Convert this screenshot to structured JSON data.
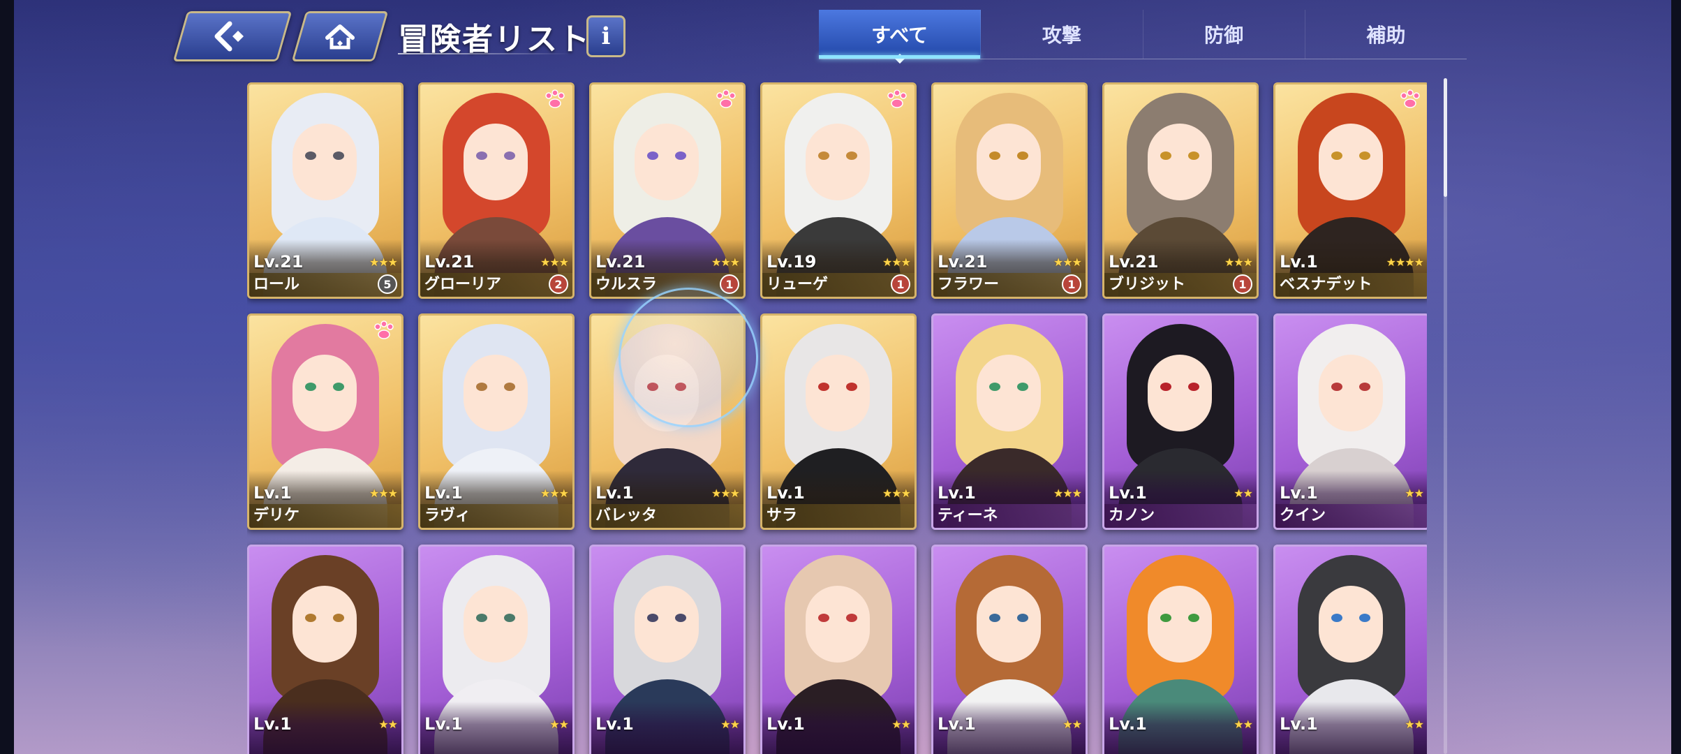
{
  "header": {
    "title": "冒険者リスト",
    "info_label": "i",
    "back_icon": "back-arrow-icon",
    "home_icon": "home-icon"
  },
  "tabs": [
    {
      "label": "すべて",
      "active": true
    },
    {
      "label": "攻撃",
      "active": false
    },
    {
      "label": "防御",
      "active": false
    },
    {
      "label": "補助",
      "active": false
    }
  ],
  "colors": {
    "gold_card": "#f0c068",
    "purple_card": "#a45fd6",
    "tab_active": "#2f5ec9",
    "star": "#ffd54a"
  },
  "adventurers": [
    {
      "name": "ロール",
      "level": "Lv.21",
      "stars": 3,
      "rank": "5",
      "frame": "gold",
      "hair": "#e8ecf4",
      "outfit": "#dfe8f6",
      "eye": "#5b5b66",
      "paw": false
    },
    {
      "name": "グローリア",
      "level": "Lv.21",
      "stars": 3,
      "rank": "2",
      "frame": "gold",
      "hair": "#d4472c",
      "outfit": "#7a4a3a",
      "eye": "#8a6fb0",
      "paw": true
    },
    {
      "name": "ウルスラ",
      "level": "Lv.21",
      "stars": 3,
      "rank": "1",
      "frame": "gold",
      "hair": "#eeeee6",
      "outfit": "#6a4ea0",
      "eye": "#7b62c8",
      "paw": true
    },
    {
      "name": "リューゲ",
      "level": "Lv.19",
      "stars": 3,
      "rank": "1",
      "frame": "gold",
      "hair": "#f0f0ee",
      "outfit": "#3a3a3a",
      "eye": "#c58a3a",
      "paw": true
    },
    {
      "name": "フラワー",
      "level": "Lv.21",
      "stars": 3,
      "rank": "1",
      "frame": "gold",
      "hair": "#e7bc7a",
      "outfit": "#b9c9e8",
      "eye": "#c48a2a",
      "paw": false
    },
    {
      "name": "ブリジット",
      "level": "Lv.21",
      "stars": 3,
      "rank": "1",
      "frame": "gold",
      "hair": "#8c7d70",
      "outfit": "#5b4a36",
      "eye": "#c8922a",
      "paw": false
    },
    {
      "name": "ベスナデット",
      "level": "Lv.1",
      "stars": 4,
      "rank": "",
      "frame": "gold",
      "hair": "#c8461e",
      "outfit": "#2e2420",
      "eye": "#c8922a",
      "paw": true
    },
    {
      "name": "デリケ",
      "level": "Lv.1",
      "stars": 3,
      "rank": "",
      "frame": "gold",
      "hair": "#e27aa0",
      "outfit": "#f4ede6",
      "eye": "#3f9a6a",
      "paw": true
    },
    {
      "name": "ラヴィ",
      "level": "Lv.1",
      "stars": 3,
      "rank": "",
      "frame": "gold",
      "hair": "#dfe5f2",
      "outfit": "#eef1f7",
      "eye": "#b07a40",
      "paw": false
    },
    {
      "name": "バレッタ",
      "level": "Lv.1",
      "stars": 3,
      "rank": "",
      "frame": "gold",
      "hair": "#f2d8c8",
      "outfit": "#2f2a3a",
      "eye": "#c23a3a",
      "paw": false
    },
    {
      "name": "サラ",
      "level": "Lv.1",
      "stars": 3,
      "rank": "",
      "frame": "gold",
      "hair": "#e8e6e6",
      "outfit": "#1f1f22",
      "eye": "#c0332e",
      "paw": false
    },
    {
      "name": "ティーネ",
      "level": "Lv.1",
      "stars": 3,
      "rank": "",
      "frame": "purple",
      "hair": "#f3d58a",
      "outfit": "#3a2a2a",
      "eye": "#3f9a6a",
      "paw": false
    },
    {
      "name": "カノン",
      "level": "Lv.1",
      "stars": 2,
      "rank": "",
      "frame": "purple",
      "hair": "#1d1a22",
      "outfit": "#2a2a30",
      "eye": "#b8222a",
      "paw": false
    },
    {
      "name": "クイン",
      "level": "Lv.1",
      "stars": 2,
      "rank": "",
      "frame": "purple",
      "hair": "#f1eeee",
      "outfit": "#d8d0d0",
      "eye": "#b83a3a",
      "paw": false
    },
    {
      "name": "",
      "level": "Lv.1",
      "stars": 2,
      "rank": "",
      "frame": "purple",
      "hair": "#6a4026",
      "outfit": "#4a2e1e",
      "eye": "#b07a30",
      "paw": false
    },
    {
      "name": "",
      "level": "Lv.1",
      "stars": 2,
      "rank": "",
      "frame": "purple",
      "hair": "#ecebef",
      "outfit": "#f0eef2",
      "eye": "#4a7a6a",
      "paw": false
    },
    {
      "name": "",
      "level": "Lv.1",
      "stars": 2,
      "rank": "",
      "frame": "purple",
      "hair": "#d8d8dc",
      "outfit": "#2a3a5a",
      "eye": "#4a4a6a",
      "paw": false
    },
    {
      "name": "",
      "level": "Lv.1",
      "stars": 2,
      "rank": "",
      "frame": "purple",
      "hair": "#e6c8b0",
      "outfit": "#2a1e24",
      "eye": "#c03a3a",
      "paw": false
    },
    {
      "name": "",
      "level": "Lv.1",
      "stars": 2,
      "rank": "",
      "frame": "purple",
      "hair": "#b56a36",
      "outfit": "#f2f2f2",
      "eye": "#3a6a9a",
      "paw": false
    },
    {
      "name": "",
      "level": "Lv.1",
      "stars": 2,
      "rank": "",
      "frame": "purple",
      "hair": "#f08a2a",
      "outfit": "#4a8a7a",
      "eye": "#3f9a3f",
      "paw": false
    },
    {
      "name": "",
      "level": "Lv.1",
      "stars": 2,
      "rank": "",
      "frame": "purple",
      "hair": "#3a3a3e",
      "outfit": "#e8e8ec",
      "eye": "#3a7ac8",
      "paw": false
    }
  ]
}
